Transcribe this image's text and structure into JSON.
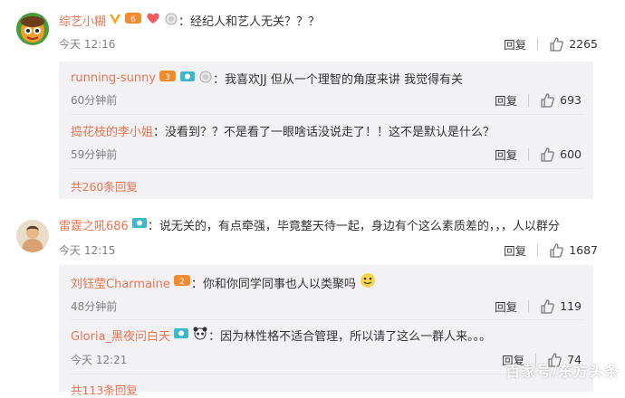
{
  "comments": [
    {
      "user": "综艺小糊",
      "text": "：经纪人和艺人无关？？？",
      "time": "今天 12:16",
      "reply_label": "回复",
      "likes": "2265",
      "replies": [
        {
          "user": "running-sunny",
          "text": "：我喜欢JJ 但从一个理智的角度来讲 我觉得有关",
          "time": "60分钟前",
          "reply_label": "回复",
          "likes": "693"
        },
        {
          "user": "捣花枝的李小姐",
          "text": "：没看到？？不是看了一眼啥话没说走了！！这不是默认是什么？",
          "time": "59分钟前",
          "reply_label": "回复",
          "likes": "600"
        }
      ],
      "more_replies": "共260条回复"
    },
    {
      "user": "雷霆之吼686",
      "text": "：说无关的，有点牵强，毕竟整天待一起，身边有个这么素质差的，，，人以群分",
      "time": "今天 12:15",
      "reply_label": "回复",
      "likes": "1687",
      "replies": [
        {
          "user": "刘钰莹Charmaine",
          "text": "：你和你同学同事也人以类聚吗",
          "time": "48分钟前",
          "reply_label": "回复",
          "likes": "119"
        },
        {
          "user": "Gloria_黑夜问白天",
          "text": "：因为林性格不适合管理，所以请了这么一群人来。。。",
          "time": "今天 12:21",
          "reply_label": "回复",
          "likes": "74"
        }
      ],
      "more_replies": "共113条回复"
    }
  ],
  "watermark": "百家号/东方头条",
  "colors": {
    "username": "#eb7350",
    "text": "#333333",
    "time": "#808080",
    "panel_bg": "#f2f2f5"
  }
}
